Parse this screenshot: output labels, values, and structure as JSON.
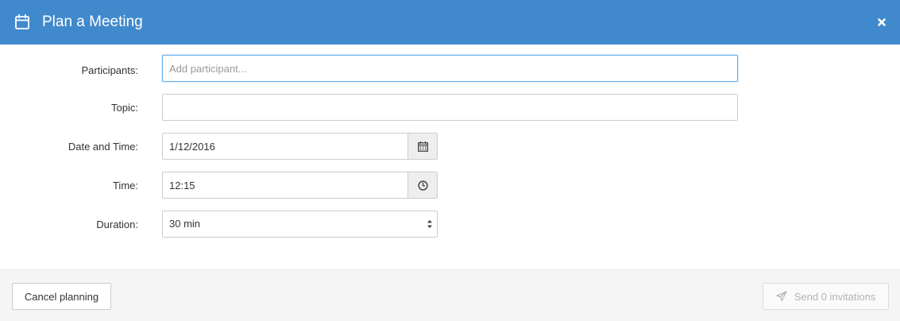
{
  "dialog": {
    "title": "Plan a Meeting",
    "icons": {
      "header": "calendar-icon",
      "close": "close-icon"
    }
  },
  "form": {
    "participants": {
      "label": "Participants:",
      "placeholder": "Add participant..."
    },
    "topic": {
      "label": "Topic:",
      "value": ""
    },
    "date": {
      "label": "Date and Time:",
      "value": "1/12/2016",
      "icon": "calendar-icon"
    },
    "time": {
      "label": "Time:",
      "value": "12:15",
      "icon": "clock-icon"
    },
    "duration": {
      "label": "Duration:",
      "selected": "30 min"
    }
  },
  "footer": {
    "cancel_label": "Cancel planning",
    "send_label": "Send 0 invitations",
    "send_icon": "paper-plane-icon"
  },
  "colors": {
    "header_bg": "#4089cc",
    "footer_bg": "#f5f5f5",
    "focus_border": "#66afe9"
  }
}
